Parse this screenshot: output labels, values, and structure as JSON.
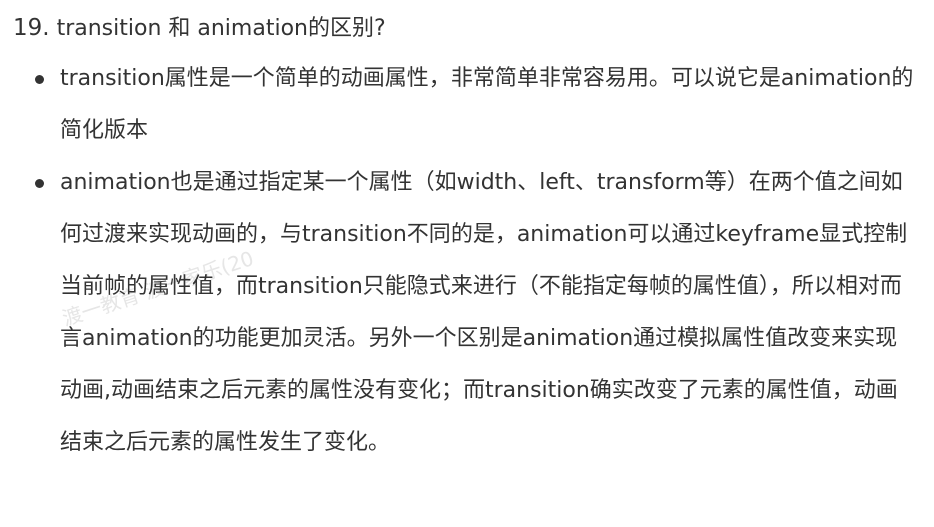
{
  "heading": {
    "number": "19.",
    "text": "transition 和 animation的区别?"
  },
  "items": [
    {
      "text": "transition属性是一个简单的动画属性，非常简单非常容易用。可以说它是animation的简化版本"
    },
    {
      "text": "animation也是通过指定某一个属性（如width、left、transform等）在两个值之间如何过渡来实现动画的，与transition不同的是，animation可以通过keyframe显式控制当前帧的属性值，而transition只能隐式来进行（不能指定每帧的属性值），所以相对而言animation的功能更加灵活。另外一个区别是animation通过模拟属性值改变来实现动画,动画结束之后元素的属性没有变化；而transition确实改变了元素的属性值，动画结束之后元素的属性发生了变化。"
    }
  ],
  "watermark": {
    "text": "渡一教育 渡一家乐(20"
  }
}
